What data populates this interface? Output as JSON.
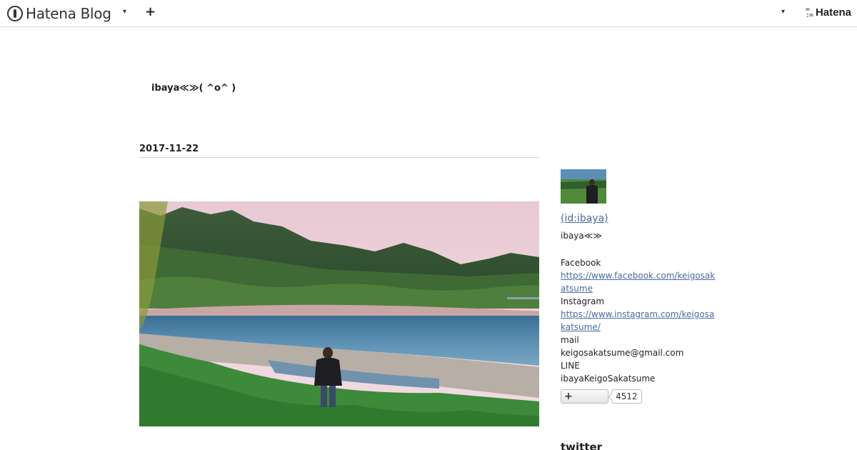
{
  "header": {
    "logo_text": "Hatena Blog",
    "add_label": "+",
    "brand_text": "Hatena",
    "icons": [
      "hatena-blog-logo-icon",
      "caret-down-icon",
      "plus-icon",
      "hatena-logo-icon"
    ]
  },
  "blog": {
    "title": "ibaya≪≫( ^o^ )"
  },
  "entry": {
    "date": "2017-11-22"
  },
  "sidebar": {
    "profile_id": " (id:ibaya)",
    "profile_name": "ibaya≪≫",
    "facebook_label": "Facebook",
    "facebook_url": "https://www.facebook.com/keigosakatsume",
    "instagram_label": "Instagram",
    "instagram_url": "https://www.instagram.com/keigosakatsume/",
    "mail_label": "mail",
    "mail_value": "keigosakatsume@gmail.com",
    "line_label": "LINE",
    "line_value": "ibayaKeigoSakatsume",
    "bookmark_label": "+",
    "bookmark_count": "4512",
    "twitter_heading": "twitter"
  },
  "colors": {
    "link": "#4a6b9e",
    "header_border": "#d8d8d8"
  }
}
